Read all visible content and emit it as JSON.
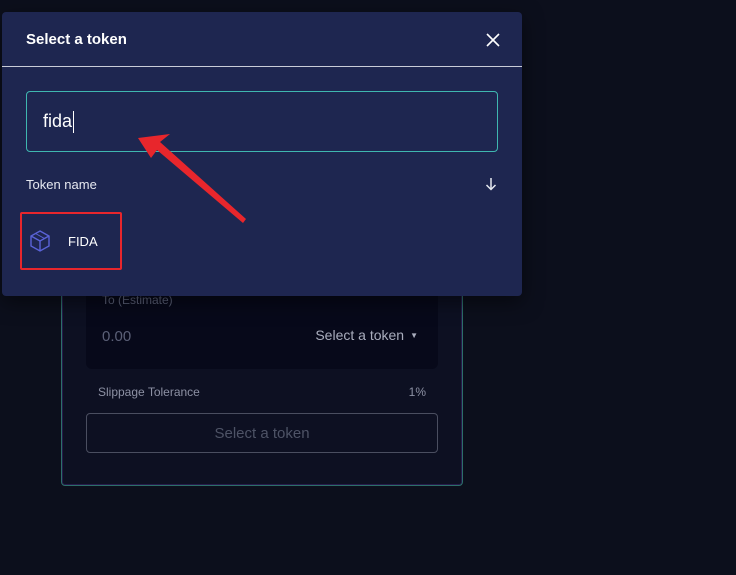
{
  "swap": {
    "to_label": "To (Estimate)",
    "to_amount": "0.00",
    "to_select_label": "Select a token",
    "slippage_label": "Slippage Tolerance",
    "slippage_value": "1%",
    "action_label": "Select a token"
  },
  "modal": {
    "title": "Select a token",
    "search_value": "fida",
    "list_header": "Token name",
    "tokens": [
      {
        "symbol": "FIDA",
        "icon": "cube-icon"
      }
    ]
  },
  "colors": {
    "modal_bg": "#1e2650",
    "page_bg": "#0c0f1c",
    "search_border": "#3fb7b0",
    "highlight_red": "#e8262c",
    "token_icon": "#5a63d8"
  }
}
